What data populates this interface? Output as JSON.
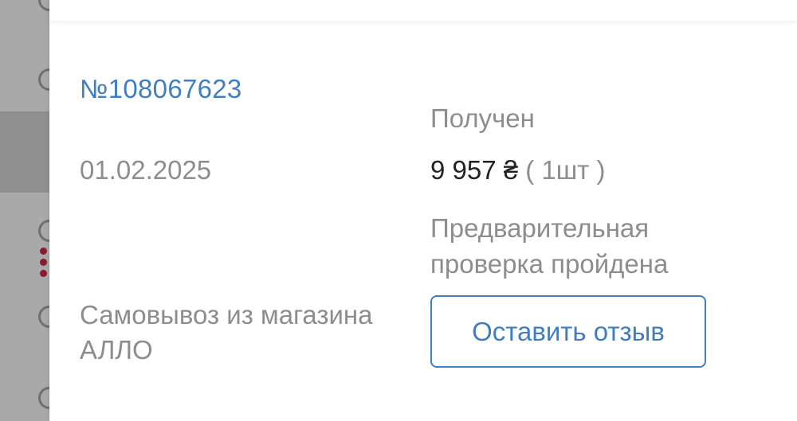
{
  "order": {
    "number": "№108067623",
    "date": "01.02.2025",
    "delivery_method": "Самовывоз из магазина АЛЛО",
    "status": "Получен",
    "price": "9 957 ₴",
    "quantity": "( 1шт )",
    "check_status": "Предварительная проверка пройдена",
    "review_button_label": "Оставить отзыв"
  },
  "colors": {
    "accent": "#3f7ec1",
    "muted_text": "#8d8d8d",
    "primary_text": "#222222",
    "overlay": "#a9a9a9",
    "active_dots": "#8a1b2a"
  }
}
